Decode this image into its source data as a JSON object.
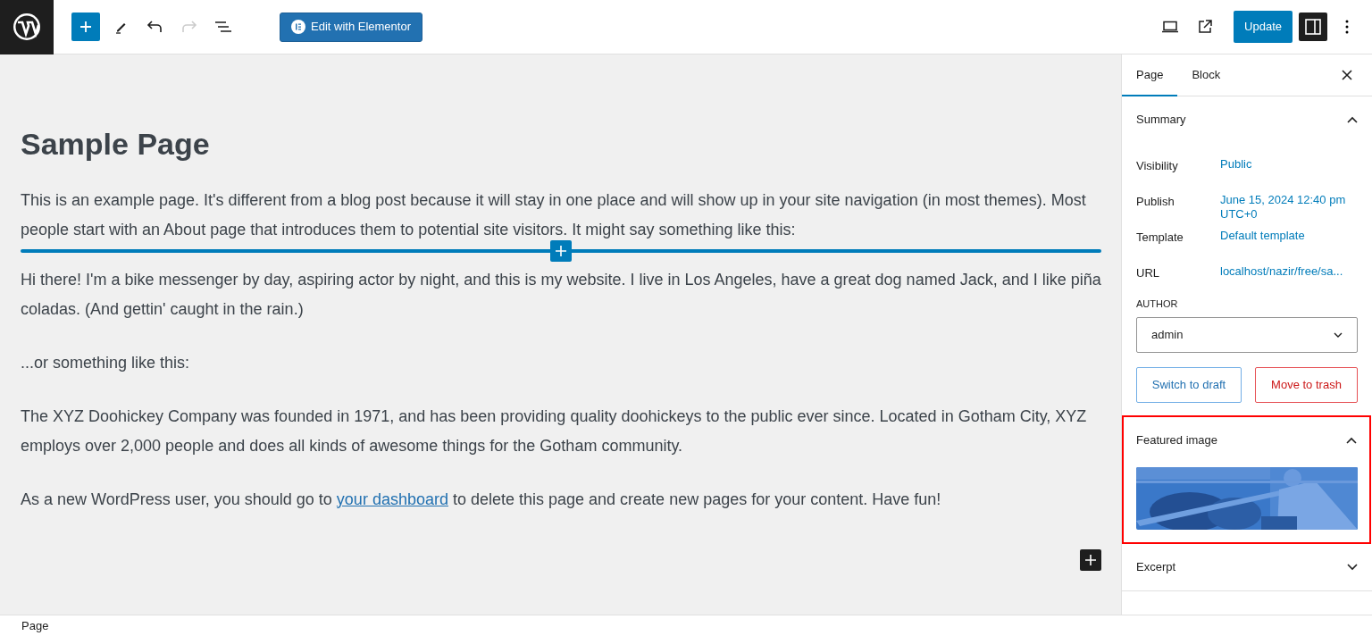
{
  "toolbar": {
    "edit_button": "Edit with Elementor",
    "update_button": "Update",
    "undo_disabled": false,
    "redo_disabled": true,
    "settings_on": true
  },
  "editor": {
    "title": "Sample Page",
    "paragraphs": [
      {
        "parts": [
          {
            "kind": "text",
            "text": "This is an example page. It's different from a blog post because it will stay in one place and will show up in your site navigation (in most themes). Most people start with an About page that introduces them to potential site visitors. It might say something like this:"
          }
        ],
        "inserter_after": true
      },
      {
        "parts": [
          {
            "kind": "text",
            "text": "Hi there! I'm a bike messenger by day, aspiring actor by night, and this is my website. I live in Los Angeles, have a great dog named Jack, and I like piña coladas. (And gettin' caught in the rain.)"
          }
        ],
        "inserter_after": false
      },
      {
        "parts": [
          {
            "kind": "text",
            "text": "...or something like this:"
          }
        ],
        "inserter_after": false
      },
      {
        "parts": [
          {
            "kind": "text",
            "text": "The XYZ Doohickey Company was founded in 1971, and has been providing quality doohickeys to the public ever since. Located in Gotham City, XYZ employs over 2,000 people and does all kinds of awesome things for the Gotham community."
          }
        ],
        "inserter_after": false
      },
      {
        "parts": [
          {
            "kind": "text",
            "text": "As a new WordPress user, you should go to "
          },
          {
            "kind": "link",
            "text": "your dashboard"
          },
          {
            "kind": "text",
            "text": " to delete this page and create new pages for your content. Have fun!"
          }
        ],
        "inserter_after": false
      }
    ]
  },
  "sidebar": {
    "tabs": [
      {
        "label": "Page",
        "selected": true
      },
      {
        "label": "Block",
        "selected": false
      }
    ],
    "summary": {
      "title": "Summary",
      "expanded": true,
      "rows": [
        {
          "label": "Visibility",
          "value": "Public"
        },
        {
          "label": "Publish",
          "value": "June 15, 2024 12:40 pm UTC+0"
        },
        {
          "label": "Template",
          "value": "Default template"
        },
        {
          "label": "URL",
          "value": "localhost/nazir/free/sa..."
        }
      ],
      "author_label": "AUTHOR",
      "author": "admin",
      "draft_button": "Switch to draft",
      "trash_button": "Move to trash"
    },
    "featured": {
      "title": "Featured image",
      "expanded": true,
      "highlighted": true
    },
    "excerpt": {
      "title": "Excerpt",
      "expanded": false
    }
  },
  "status_bar": "Page"
}
